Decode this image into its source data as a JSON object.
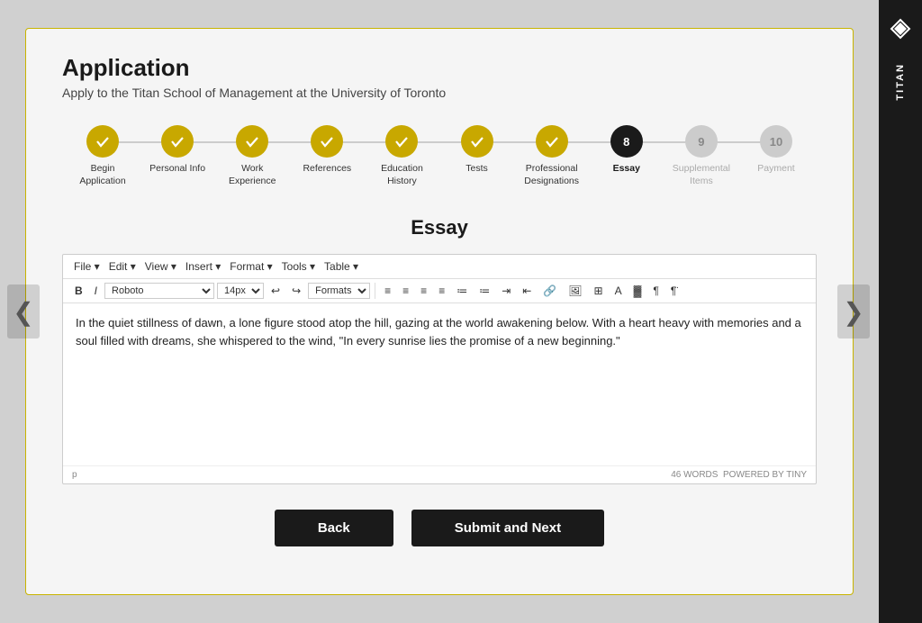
{
  "page": {
    "title": "Application",
    "subtitle": "Apply to the Titan School of Management at the University of Toronto"
  },
  "sidebar": {
    "brand": "TITAN"
  },
  "nav": {
    "left_arrow": "❮",
    "right_arrow": "❯"
  },
  "steps": [
    {
      "id": 1,
      "label": "Begin Application",
      "state": "completed"
    },
    {
      "id": 2,
      "label": "Personal Info",
      "state": "completed"
    },
    {
      "id": 3,
      "label": "Work Experience",
      "state": "completed"
    },
    {
      "id": 4,
      "label": "References",
      "state": "completed"
    },
    {
      "id": 5,
      "label": "Education History",
      "state": "completed"
    },
    {
      "id": 6,
      "label": "Tests",
      "state": "completed"
    },
    {
      "id": 7,
      "label": "Professional Designations",
      "state": "completed"
    },
    {
      "id": 8,
      "label": "Essay",
      "state": "active"
    },
    {
      "id": 9,
      "label": "Supplemental Items",
      "state": "inactive"
    },
    {
      "id": 10,
      "label": "Payment",
      "state": "inactive"
    }
  ],
  "section": {
    "title": "Essay"
  },
  "editor": {
    "menu_items": [
      "File",
      "Edit",
      "View",
      "Insert",
      "Format",
      "Tools",
      "Table"
    ],
    "font": "Roboto",
    "font_size": "14px",
    "formats_label": "Formats",
    "content": "In the quiet stillness of dawn, a lone figure stood atop the hill, gazing at the world awakening below. With a heart heavy with memories and a soul filled with dreams, she whispered to the wind, \"In every sunrise lies the promise of a new beginning.\"",
    "footer_tag": "p",
    "word_count": "46 WORDS",
    "powered_by": "POWERED BY TINY"
  },
  "buttons": {
    "back_label": "Back",
    "submit_label": "Submit and Next"
  }
}
